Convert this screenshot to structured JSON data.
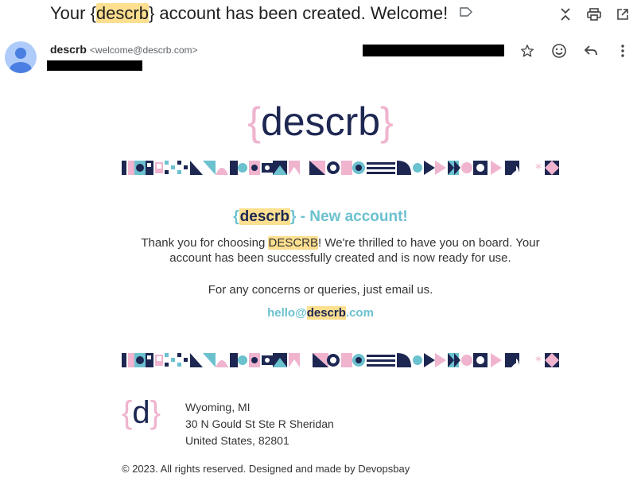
{
  "subject": {
    "prefix": "Your {",
    "highlight": "descrb",
    "suffix": "} account has been created. Welcome!"
  },
  "icons": {
    "label": "label-icon",
    "collapse": "collapse-icon",
    "print": "print-icon",
    "open_new": "open-in-new-window-icon",
    "avatar": "person-icon",
    "star": "star-icon",
    "emoji": "emoji-icon",
    "reply": "reply-icon",
    "more": "more-vert-icon"
  },
  "sender": {
    "name": "descrb",
    "email": "<welcome@descrb.com>"
  },
  "email_body": {
    "logo_open": "{",
    "logo_text": "descrb",
    "logo_close": "}",
    "headline_open": "{",
    "headline_brand": "descrb",
    "headline_close": "}",
    "headline_suffix": " - New account!",
    "message_prefix": "Thank you for choosing ",
    "message_brand": "DESCRB",
    "message_suffix": "! We're thrilled to have you on board. Your account has been successfully created and is now ready for use.",
    "concern": "For any concerns or queries, just email us.",
    "email_user": "hello@",
    "email_brand": "descrb",
    "email_domain": ".com"
  },
  "footer": {
    "logo_open": "{",
    "logo_letter": "d",
    "logo_close": "}",
    "address_line1": "Wyoming, MI",
    "address_line2": "30 N Gould St Ste R Sheridan",
    "address_line3": "United States, 82801",
    "copyright": "© 2023. All rights reserved. Designed and made by Devopsbay"
  },
  "colors": {
    "navy": "#1d2752",
    "pink": "#f0b4cf",
    "teal": "#6cc1cf",
    "highlight": "#fcdf8f"
  }
}
